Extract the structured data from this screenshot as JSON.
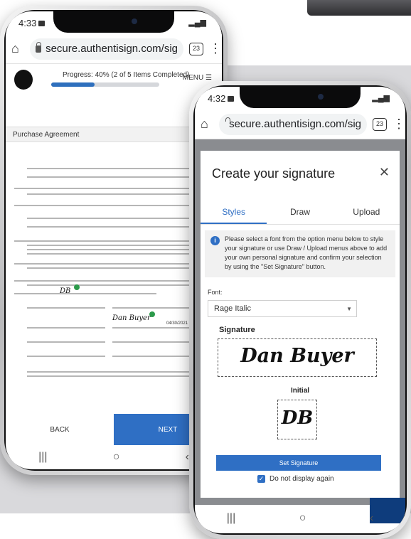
{
  "phone_back": {
    "status": {
      "time": "4:33"
    },
    "browser": {
      "url": "secure.authentisign.com/sig",
      "tab_count": "23"
    },
    "progress": {
      "text": "Progress: 40% (2 of 5 Items Completed)",
      "fraction": 0.4,
      "menu_label": "MENU"
    },
    "document": {
      "title": "Purchase Agreement",
      "buyer_signature": "Dan Buyer",
      "buyer_initials": "DB",
      "date": "04/30/2021"
    },
    "nav": {
      "back_label": "BACK",
      "next_label": "NEXT"
    }
  },
  "phone_front": {
    "status": {
      "time": "4:32"
    },
    "browser": {
      "url": "secure.authentisign.com/sig",
      "tab_count": "23"
    },
    "modal": {
      "title": "Create your signature",
      "tabs": [
        {
          "label": "Styles",
          "active": true
        },
        {
          "label": "Draw",
          "active": false
        },
        {
          "label": "Upload",
          "active": false
        }
      ],
      "info_text": "Please select a font from the option menu below to style your signature or use Draw / Upload menus above to add your own personal signature and confirm your selection by using the \"Set Signature\" button.",
      "font_label": "Font:",
      "font_value": "Rage Italic",
      "signature_label": "Signature",
      "signature_preview": "Dan Buyer",
      "initial_label": "Initial",
      "initial_preview": "DB",
      "set_button": "Set Signature",
      "checkbox_label": "Do not display again",
      "checkbox_checked": true
    }
  },
  "colors": {
    "accent": "#2f6fc4",
    "dark_blue": "#0e3c7c",
    "success": "#2b9a4a"
  }
}
